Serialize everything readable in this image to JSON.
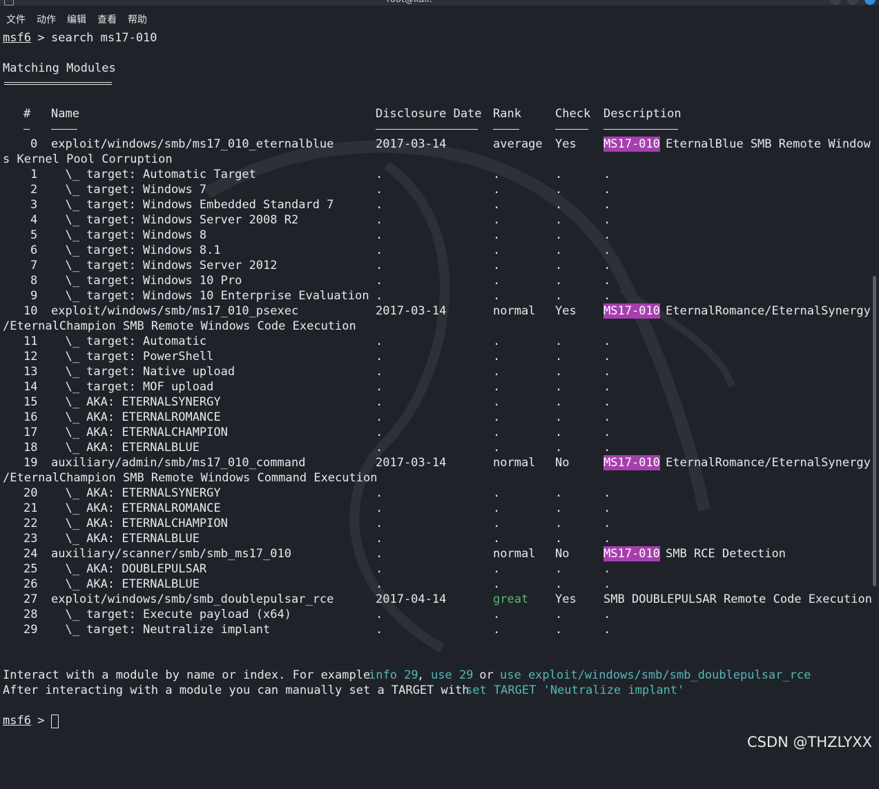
{
  "window": {
    "title": "root@kali: ~"
  },
  "menu": [
    "文件",
    "动作",
    "编辑",
    "查看",
    "帮助"
  ],
  "prompt": {
    "name": "msf6",
    "sep": " > "
  },
  "command": "search ms17-010",
  "heading": "Matching Modules",
  "headers": {
    "num": "#",
    "name": "Name",
    "date": "Disclosure Date",
    "rank": "Rank",
    "check": "Check",
    "desc": "Description"
  },
  "tag": "MS17-010",
  "rows": [
    {
      "num": "0",
      "name": "exploit/windows/smb/ms17_010_eternalblue",
      "date": "2017-03-14",
      "rank": "average",
      "check": "Yes",
      "tag": true,
      "desc": "EternalBlue SMB Remote Window",
      "wrap": "s Kernel Pool Corruption"
    },
    {
      "num": "1",
      "name": "  \\_ target: Automatic Target",
      "date": ".",
      "rank": ".",
      "check": ".",
      "desc": "."
    },
    {
      "num": "2",
      "name": "  \\_ target: Windows 7",
      "date": ".",
      "rank": ".",
      "check": ".",
      "desc": "."
    },
    {
      "num": "3",
      "name": "  \\_ target: Windows Embedded Standard 7",
      "date": ".",
      "rank": ".",
      "check": ".",
      "desc": "."
    },
    {
      "num": "4",
      "name": "  \\_ target: Windows Server 2008 R2",
      "date": ".",
      "rank": ".",
      "check": ".",
      "desc": "."
    },
    {
      "num": "5",
      "name": "  \\_ target: Windows 8",
      "date": ".",
      "rank": ".",
      "check": ".",
      "desc": "."
    },
    {
      "num": "6",
      "name": "  \\_ target: Windows 8.1",
      "date": ".",
      "rank": ".",
      "check": ".",
      "desc": "."
    },
    {
      "num": "7",
      "name": "  \\_ target: Windows Server 2012",
      "date": ".",
      "rank": ".",
      "check": ".",
      "desc": "."
    },
    {
      "num": "8",
      "name": "  \\_ target: Windows 10 Pro",
      "date": ".",
      "rank": ".",
      "check": ".",
      "desc": "."
    },
    {
      "num": "9",
      "name": "  \\_ target: Windows 10 Enterprise Evaluation",
      "date": ".",
      "rank": ".",
      "check": ".",
      "desc": "."
    },
    {
      "num": "10",
      "name": "exploit/windows/smb/ms17_010_psexec",
      "date": "2017-03-14",
      "rank": "normal",
      "check": "Yes",
      "tag": true,
      "desc": "EternalRomance/EternalSynergy",
      "wrap": "/EternalChampion SMB Remote Windows Code Execution"
    },
    {
      "num": "11",
      "name": "  \\_ target: Automatic",
      "date": ".",
      "rank": ".",
      "check": ".",
      "desc": "."
    },
    {
      "num": "12",
      "name": "  \\_ target: PowerShell",
      "date": ".",
      "rank": ".",
      "check": ".",
      "desc": "."
    },
    {
      "num": "13",
      "name": "  \\_ target: Native upload",
      "date": ".",
      "rank": ".",
      "check": ".",
      "desc": "."
    },
    {
      "num": "14",
      "name": "  \\_ target: MOF upload",
      "date": ".",
      "rank": ".",
      "check": ".",
      "desc": "."
    },
    {
      "num": "15",
      "name": "  \\_ AKA: ETERNALSYNERGY",
      "date": ".",
      "rank": ".",
      "check": ".",
      "desc": "."
    },
    {
      "num": "16",
      "name": "  \\_ AKA: ETERNALROMANCE",
      "date": ".",
      "rank": ".",
      "check": ".",
      "desc": "."
    },
    {
      "num": "17",
      "name": "  \\_ AKA: ETERNALCHAMPION",
      "date": ".",
      "rank": ".",
      "check": ".",
      "desc": "."
    },
    {
      "num": "18",
      "name": "  \\_ AKA: ETERNALBLUE",
      "date": ".",
      "rank": ".",
      "check": ".",
      "desc": "."
    },
    {
      "num": "19",
      "name": "auxiliary/admin/smb/ms17_010_command",
      "date": "2017-03-14",
      "rank": "normal",
      "check": "No",
      "tag": true,
      "desc": "EternalRomance/EternalSynergy",
      "wrap": "/EternalChampion SMB Remote Windows Command Execution"
    },
    {
      "num": "20",
      "name": "  \\_ AKA: ETERNALSYNERGY",
      "date": ".",
      "rank": ".",
      "check": ".",
      "desc": "."
    },
    {
      "num": "21",
      "name": "  \\_ AKA: ETERNALROMANCE",
      "date": ".",
      "rank": ".",
      "check": ".",
      "desc": "."
    },
    {
      "num": "22",
      "name": "  \\_ AKA: ETERNALCHAMPION",
      "date": ".",
      "rank": ".",
      "check": ".",
      "desc": "."
    },
    {
      "num": "23",
      "name": "  \\_ AKA: ETERNALBLUE",
      "date": ".",
      "rank": ".",
      "check": ".",
      "desc": "."
    },
    {
      "num": "24",
      "name": "auxiliary/scanner/smb/smb_ms17_010",
      "date": ".",
      "rank": "normal",
      "check": "No",
      "tag": true,
      "desc": "SMB RCE Detection"
    },
    {
      "num": "25",
      "name": "  \\_ AKA: DOUBLEPULSAR",
      "date": ".",
      "rank": ".",
      "check": ".",
      "desc": "."
    },
    {
      "num": "26",
      "name": "  \\_ AKA: ETERNALBLUE",
      "date": ".",
      "rank": ".",
      "check": ".",
      "desc": "."
    },
    {
      "num": "27",
      "name": "exploit/windows/smb/smb_doublepulsar_rce",
      "date": "2017-04-14",
      "rank": "great",
      "rankColor": "green",
      "check": "Yes",
      "desc": "SMB DOUBLEPULSAR Remote Code Execution"
    },
    {
      "num": "28",
      "name": "  \\_ target: Execute payload (x64)",
      "date": ".",
      "rank": ".",
      "check": ".",
      "desc": "."
    },
    {
      "num": "29",
      "name": "  \\_ target: Neutralize implant",
      "date": ".",
      "rank": ".",
      "check": ".",
      "desc": "."
    }
  ],
  "footer": {
    "line1": [
      {
        "t": "Interact with a module by name or index. For example ",
        "c": ""
      },
      {
        "t": "info 29",
        "c": "cyan"
      },
      {
        "t": ", ",
        "c": ""
      },
      {
        "t": "use 29",
        "c": "cyan"
      },
      {
        "t": " or ",
        "c": ""
      },
      {
        "t": "use exploit/windows/smb/smb_doublepulsar_rce",
        "c": "cyan"
      }
    ],
    "line2": [
      {
        "t": "After interacting with a module you can manually set a TARGET with ",
        "c": ""
      },
      {
        "t": "set TARGET 'Neutralize implant'",
        "c": "cyan"
      }
    ]
  },
  "watermark": "CSDN @THZLYXX",
  "colors": {
    "background": "#1f2329",
    "highlight": "#a63fae",
    "cyan": "#55b7b6",
    "green": "#5cb56a"
  }
}
